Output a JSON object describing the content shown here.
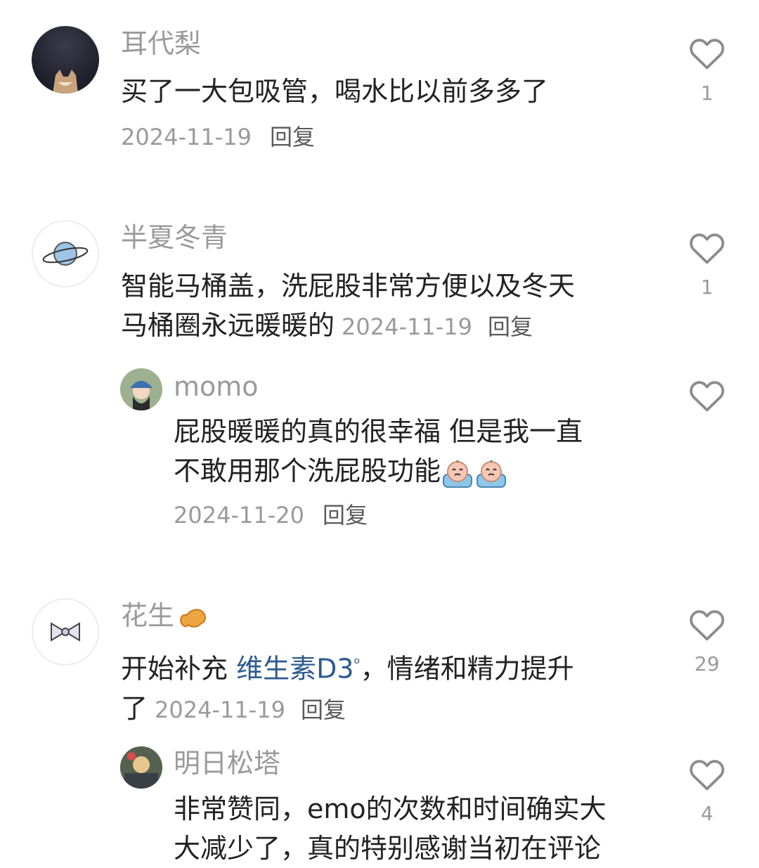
{
  "comments": [
    {
      "name": "耳代梨",
      "text": "买了一大包吸管，喝水比以前多多了",
      "date": "2024-11-19",
      "reply": "回复",
      "likes": "1"
    },
    {
      "name": "半夏冬青",
      "text_line1": "智能马桶盖，洗屁股非常方便以及冬天",
      "text_line2": "马桶圈永远暖暖的",
      "date": "2024-11-19",
      "reply": "回复",
      "likes": "1"
    },
    {
      "name": "momo",
      "text_line1": "屁股暖暖的真的很幸福 但是我一直",
      "text_line2": "不敢用那个洗屁股功能",
      "date": "2024-11-20",
      "reply": "回复"
    },
    {
      "name": "花生",
      "text_prefix": "开始补充 ",
      "link": "维生素D3",
      "text_suffix": "，情绪和精力提升",
      "text_line2": "了",
      "date": "2024-11-19",
      "reply": "回复",
      "likes": "29"
    },
    {
      "name": "明日松塔",
      "text_line1": "非常赞同，emo的次数和时间确实大",
      "text_line2": "大减少了，真的特别感谢当初在评论",
      "likes": "4"
    }
  ],
  "colors": {
    "name": "#9a9a9a",
    "text": "#222222",
    "link": "#2c5a8f",
    "heart_outline": "#8c8c8c"
  }
}
